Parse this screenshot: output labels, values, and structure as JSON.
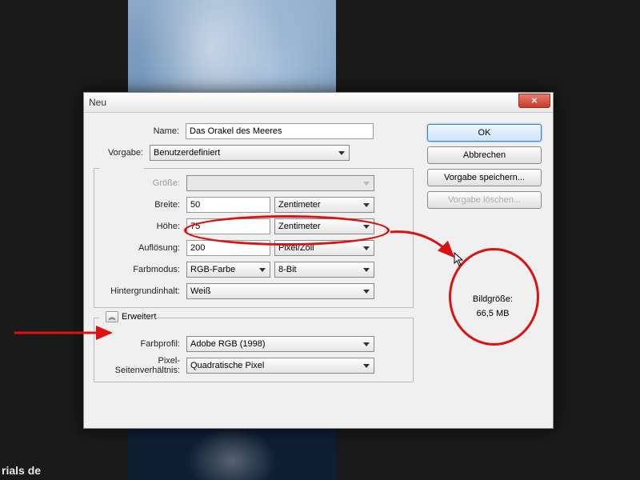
{
  "dialog": {
    "title": "Neu",
    "name_label": "Name:",
    "name_value": "Das Orakel des Meeres",
    "preset_label": "Vorgabe:",
    "preset_value": "Benutzerdefiniert",
    "size_label": "Größe:",
    "width_label": "Breite:",
    "width_value": "50",
    "width_unit": "Zentimeter",
    "height_label": "Höhe:",
    "height_value": "75",
    "height_unit": "Zentimeter",
    "resolution_label": "Auflösung:",
    "resolution_value": "200",
    "resolution_unit": "Pixel/Zoll",
    "colormode_label": "Farbmodus:",
    "colormode_value": "RGB-Farbe",
    "bitdepth_value": "8-Bit",
    "bgcontent_label": "Hintergrundinhalt:",
    "bgcontent_value": "Weiß",
    "advanced_label": "Erweitert",
    "colorprofile_label": "Farbprofil:",
    "colorprofile_value": "Adobe RGB (1998)",
    "pixelaspect_label": "Pixel-Seitenverhältnis:",
    "pixelaspect_value": "Quadratische Pixel"
  },
  "buttons": {
    "ok": "OK",
    "cancel": "Abbrechen",
    "save_preset": "Vorgabe speichern...",
    "delete_preset": "Vorgabe löschen..."
  },
  "info": {
    "image_size_label": "Bildgröße:",
    "image_size_value": "66,5 MB"
  },
  "watermark": "rials de"
}
